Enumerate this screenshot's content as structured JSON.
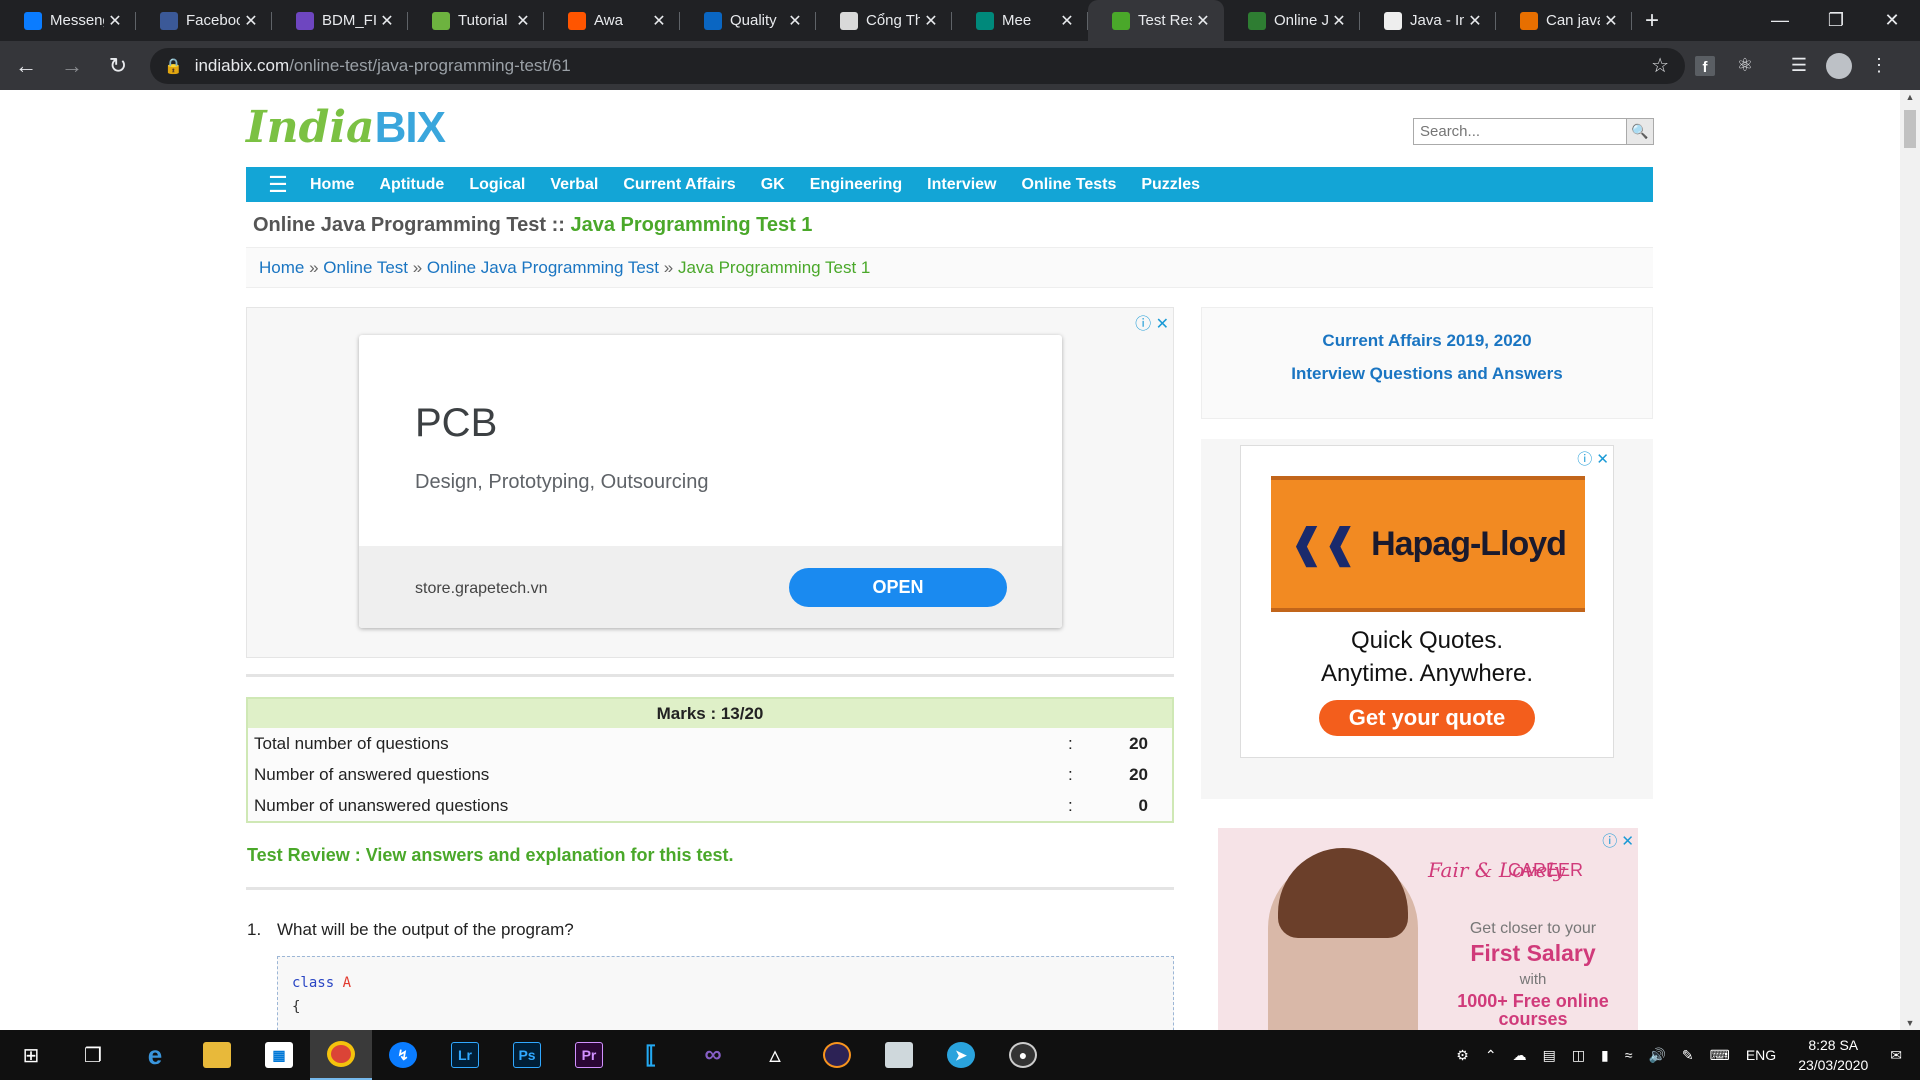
{
  "browser": {
    "tabs": [
      {
        "title": "Messeng",
        "icon": "messenger-icon",
        "color": "#0a7cff"
      },
      {
        "title": "Faceboo",
        "icon": "facebook-icon",
        "color": "#3b5998"
      },
      {
        "title": "BDM_FIT",
        "icon": "teams-icon",
        "color": "#6e46c0"
      },
      {
        "title": "Tutorial",
        "icon": "spring-icon",
        "color": "#6db33f"
      },
      {
        "title": "Awa",
        "icon": "soundcloud-icon",
        "color": "#ff5500"
      },
      {
        "title": "Quality",
        "icon": "linkedin-icon",
        "color": "#0a66c2"
      },
      {
        "title": "Cổng Th",
        "icon": "portal-icon",
        "color": "#d9d9d9"
      },
      {
        "title": "Mee",
        "icon": "meet-icon",
        "color": "#00897b"
      },
      {
        "title": "Test Res",
        "icon": "indiabix-icon",
        "color": "#4aa82a",
        "active": true
      },
      {
        "title": "Online J",
        "icon": "code-icon",
        "color": "#2e7d32"
      },
      {
        "title": "Java - In",
        "icon": "java-site-icon",
        "color": "#eeeeee"
      },
      {
        "title": "Can java",
        "icon": "java-icon",
        "color": "#e76f00"
      }
    ],
    "url_host": "indiabix.com",
    "url_path": "/online-test/java-programming-test/61"
  },
  "site": {
    "logo_part1": "India",
    "logo_part2": "BIX",
    "search_placeholder": "Search...",
    "nav": [
      "Home",
      "Aptitude",
      "Logical",
      "Verbal",
      "Current Affairs",
      "GK",
      "Engineering",
      "Interview",
      "Online Tests",
      "Puzzles"
    ],
    "page_title_prefix": "Online Java Programming Test :: ",
    "page_title_main": "Java Programming Test 1",
    "breadcrumb": {
      "home": "Home",
      "online_test": "Online Test",
      "java_test": "Online Java Programming Test",
      "current": "Java Programming Test 1",
      "sep": " » "
    }
  },
  "ad_pcb": {
    "heading": "PCB",
    "subheading": "Design, Prototyping, Outsourcing",
    "url": "store.grapetech.vn",
    "button": "OPEN"
  },
  "marks": {
    "header": "Marks : 13/20",
    "rows": [
      {
        "label": "Total number of questions",
        "value": "20"
      },
      {
        "label": "Number of answered questions",
        "value": "20"
      },
      {
        "label": "Number of unanswered questions",
        "value": "0"
      }
    ]
  },
  "review_link": "Test Review : View answers and explanation for this test.",
  "question": {
    "number": "1.",
    "text": "What will be the output of the program?",
    "code_line1_kw": "class",
    "code_line1_name": "A",
    "code_line2": "{"
  },
  "sidebar": {
    "link1": "Current Affairs 2019, 2020",
    "link2": "Interview Questions and Answers"
  },
  "ad_hapag": {
    "brand": "Hapag-Lloyd",
    "line1": "Quick Quotes.",
    "line2": "Anytime. Anywhere.",
    "cta": "Get your quote"
  },
  "ad_fair": {
    "brand1": "Fair & Lovely",
    "brand2": "CAREER",
    "line1": "Get closer to your",
    "line2": "First Salary",
    "line3": "with",
    "line4": "1000+ Free online courses"
  },
  "taskbar": {
    "language": "ENG",
    "time": "8:28 SA",
    "date": "23/03/2020"
  }
}
